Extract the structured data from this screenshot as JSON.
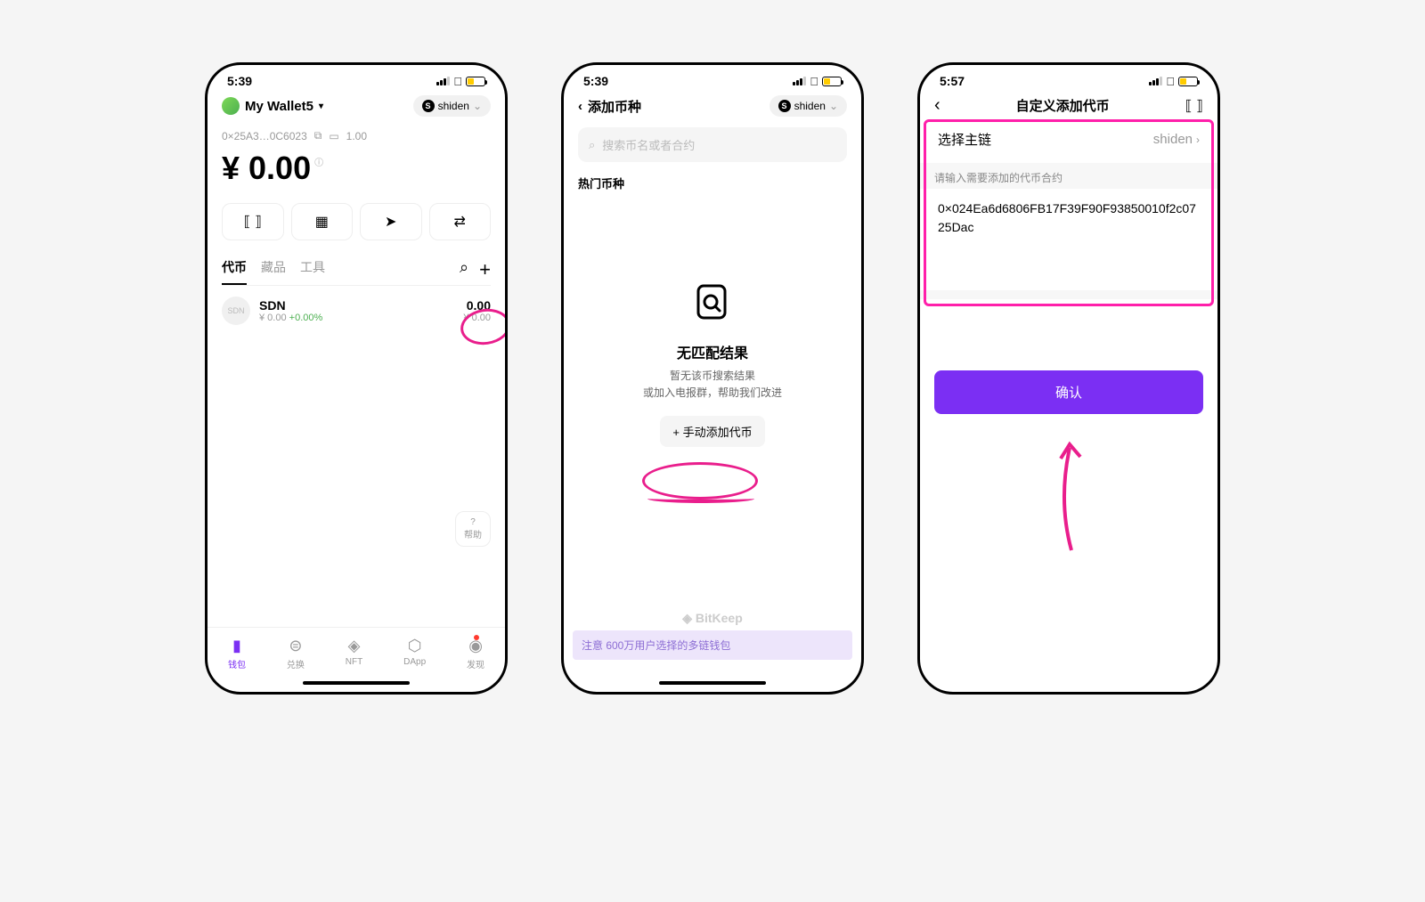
{
  "screen1": {
    "time": "5:39",
    "wallet_name": "My Wallet5",
    "chain": "shiden",
    "address_short": "0×25A3…0C6023",
    "stake_amount": "1.00",
    "balance": "¥ 0.00",
    "actions": {
      "scan": "⟦ ⟧",
      "receive": "▦",
      "send": "➤",
      "swap": "⇄"
    },
    "tabs": [
      "代币",
      "藏品",
      "工具"
    ],
    "token": {
      "icon": "SDN",
      "name": "SDN",
      "price": "¥ 0.00",
      "change": "+0.00%",
      "amount": "0.00",
      "fiat": "¥ 0.00"
    },
    "help_label": "帮助",
    "nav": [
      {
        "label": "钱包",
        "icon": "▮"
      },
      {
        "label": "兑换",
        "icon": "⊜"
      },
      {
        "label": "NFT",
        "icon": "◈"
      },
      {
        "label": "DApp",
        "icon": "⬡"
      },
      {
        "label": "发现",
        "icon": "◉"
      }
    ]
  },
  "screen2": {
    "time": "5:39",
    "title": "添加币种",
    "chain": "shiden",
    "search_placeholder": "搜索币名或者合约",
    "section_label": "热门币种",
    "empty_title": "无匹配结果",
    "empty_sub1": "暂无该币搜索结果",
    "empty_sub2": "或加入电报群，帮助我们改进",
    "manual_add": "+ 手动添加代币",
    "brand": "BitKeep",
    "promo": "注意   600万用户选择的多链钱包"
  },
  "screen3": {
    "time": "5:57",
    "title": "自定义添加代币",
    "chain_label": "选择主链",
    "chain_value": "shiden",
    "field_label": "请输入需要添加的代币合约",
    "contract": "0×024Ea6d6806FB17F39F90F93850010f2c0725Dac",
    "confirm": "确认"
  }
}
